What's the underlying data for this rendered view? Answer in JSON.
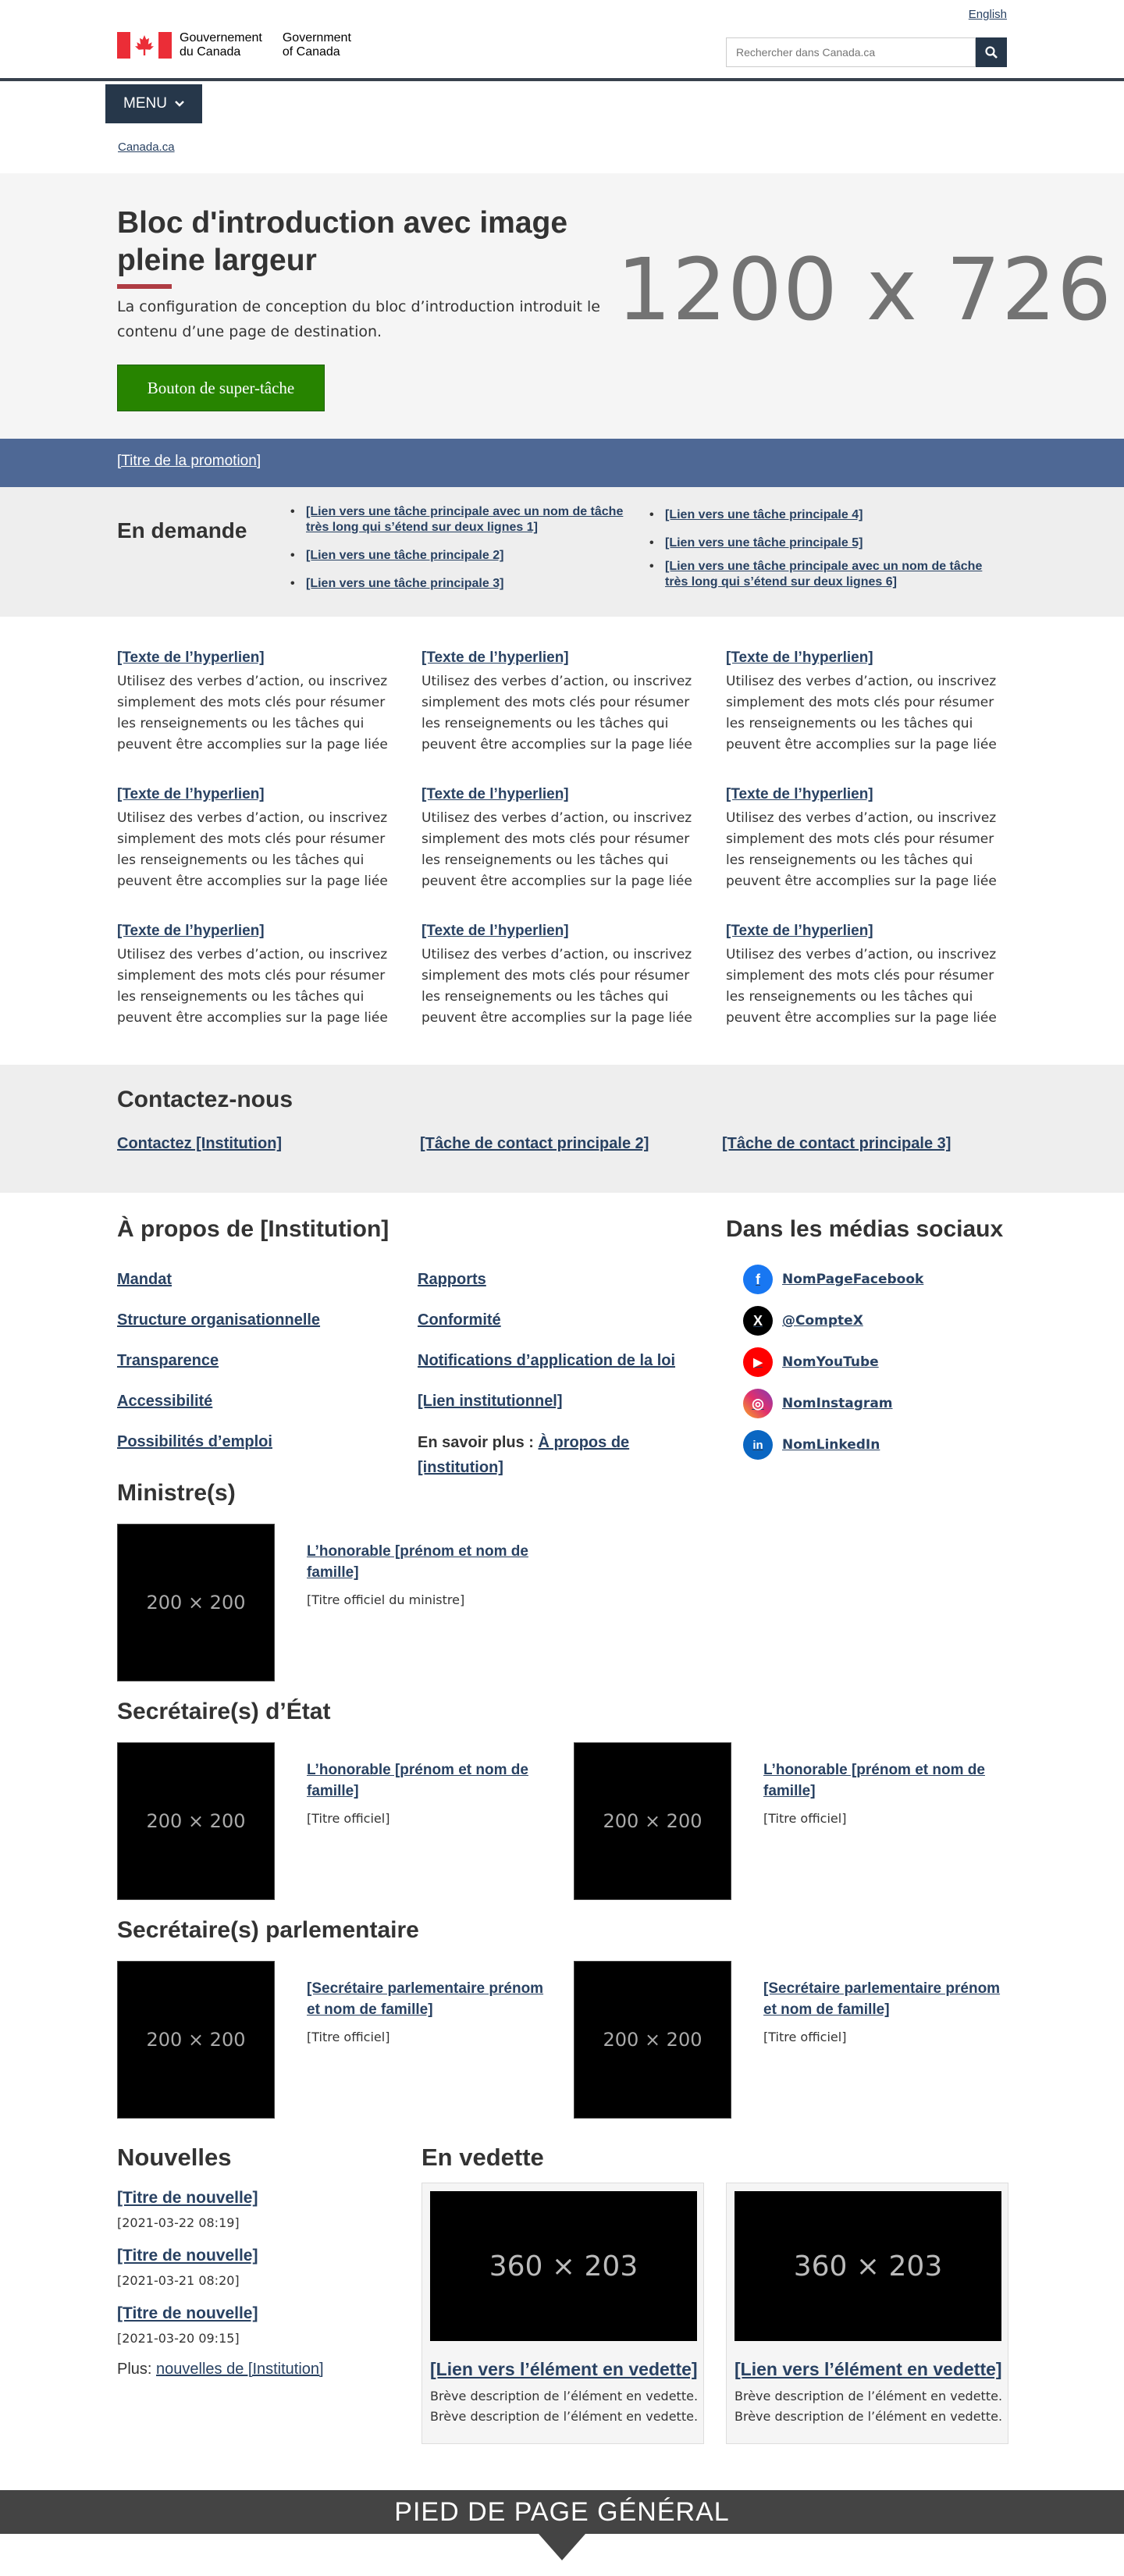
{
  "header": {
    "language_link": "English",
    "signature_fr": "Gouvernement\ndu Canada",
    "signature_en": "Government\nof Canada",
    "search_placeholder": "Rechercher dans Canada.ca"
  },
  "menu": {
    "label": "MENU"
  },
  "breadcrumb": {
    "home": "Canada.ca"
  },
  "hero": {
    "title": "Bloc d'introduction avec image pleine largeur",
    "description": "La configuration de conception du bloc d’introduction introduit le contenu d’une page de destination.",
    "button": "Bouton de super-tâche",
    "image_placeholder": "1200 x 726"
  },
  "promo": {
    "link": "[Titre de la promotion]"
  },
  "in_demand": {
    "title": "En demande",
    "col1": [
      "[Lien vers une tâche principale avec un nom de tâche très long qui s’étend sur deux lignes 1]",
      "[Lien vers une tâche principale 2]",
      "[Lien vers une tâche principale 3]"
    ],
    "col2": [
      "[Lien vers une tâche principale 4]",
      "[Lien vers une tâche principale 5]",
      "[Lien vers une tâche principale avec un nom de tâche très long qui s’étend sur deux lignes 6]"
    ]
  },
  "link_grid": {
    "items": [
      {
        "link": "[Texte de l’hyperlien]",
        "desc": "Utilisez des verbes d’action, ou inscrivez simplement des mots clés pour résumer les renseignements ou les tâches qui peuvent être accomplies sur la page liée"
      },
      {
        "link": "[Texte de l’hyperlien]",
        "desc": "Utilisez des verbes d’action, ou inscrivez simplement des mots clés pour résumer les renseignements ou les tâches qui peuvent être accomplies sur la page liée"
      },
      {
        "link": "[Texte de l’hyperlien]",
        "desc": "Utilisez des verbes d’action, ou inscrivez simplement des mots clés pour résumer les renseignements ou les tâches qui peuvent être accomplies sur la page liée"
      },
      {
        "link": "[Texte de l’hyperlien]",
        "desc": "Utilisez des verbes d’action, ou inscrivez simplement des mots clés pour résumer les renseignements ou les tâches qui peuvent être accomplies sur la page liée"
      },
      {
        "link": "[Texte de l’hyperlien]",
        "desc": "Utilisez des verbes d’action, ou inscrivez simplement des mots clés pour résumer les renseignements ou les tâches qui peuvent être accomplies sur la page liée"
      },
      {
        "link": "[Texte de l’hyperlien]",
        "desc": "Utilisez des verbes d’action, ou inscrivez simplement des mots clés pour résumer les renseignements ou les tâches qui peuvent être accomplies sur la page liée"
      },
      {
        "link": "[Texte de l’hyperlien]",
        "desc": "Utilisez des verbes d’action, ou inscrivez simplement des mots clés pour résumer les renseignements ou les tâches qui peuvent être accomplies sur la page liée"
      },
      {
        "link": "[Texte de l’hyperlien]",
        "desc": "Utilisez des verbes d’action, ou inscrivez simplement des mots clés pour résumer les renseignements ou les tâches qui peuvent être accomplies sur la page liée"
      },
      {
        "link": "[Texte de l’hyperlien]",
        "desc": "Utilisez des verbes d’action, ou inscrivez simplement des mots clés pour résumer les renseignements ou les tâches qui peuvent être accomplies sur la page liée"
      }
    ]
  },
  "contact": {
    "title": "Contactez-nous",
    "links": [
      "Contactez [Institution]",
      "[Tâche de contact principale 2]",
      "[Tâche de contact principale 3]"
    ]
  },
  "about": {
    "title": "À propos de [Institution]",
    "col1": [
      "Mandat",
      "Structure organisationnelle",
      "Transparence",
      "Accessibilité",
      "Possibilités d’emploi"
    ],
    "col2": [
      "Rapports",
      "Conformité",
      "Notifications d’application de la loi",
      "[Lien institutionnel]"
    ],
    "more_prefix": "En savoir plus : ",
    "more_link": "À propos de [institution]"
  },
  "social": {
    "title": "Dans les médias sociaux",
    "items": [
      {
        "icon": "facebook-icon",
        "label": "NomPageFacebook",
        "color": "#1877f2",
        "glyph": "f"
      },
      {
        "icon": "x-icon",
        "label": "@CompteX",
        "color": "#000000",
        "glyph": "X"
      },
      {
        "icon": "youtube-icon",
        "label": "NomYouTube",
        "color": "#ff0000",
        "glyph": "▶"
      },
      {
        "icon": "instagram-icon",
        "label": "NomInstagram",
        "color": "#c13584",
        "glyph": "◎"
      },
      {
        "icon": "linkedin-icon",
        "label": "NomLinkedIn",
        "color": "#0a66c2",
        "glyph": "in"
      }
    ]
  },
  "ministers": {
    "title": "Ministre(s)",
    "items": [
      {
        "image": "200 × 200",
        "name": "L’honorable [prénom et nom de famille]",
        "role": "[Titre officiel du ministre]"
      }
    ]
  },
  "secretaries_state": {
    "title": "Secrétaire(s) d’État",
    "items": [
      {
        "image": "200 × 200",
        "name": "L’honorable [prénom et nom de famille]",
        "role": "[Titre officiel]"
      },
      {
        "image": "200 × 200",
        "name": "L’honorable [prénom et nom de famille]",
        "role": "[Titre officiel]"
      }
    ]
  },
  "parliamentary": {
    "title": "Secrétaire(s) parlementaire",
    "items": [
      {
        "image": "200 × 200",
        "name": "[Secrétaire parlementaire prénom et nom de famille]",
        "role": "[Titre officiel]"
      },
      {
        "image": "200 × 200",
        "name": "[Secrétaire parlementaire prénom et nom de famille]",
        "role": "[Titre officiel]"
      }
    ]
  },
  "news": {
    "title": "Nouvelles",
    "items": [
      {
        "title": "[Titre de nouvelle]",
        "date": "[2021-03-22 08:19]"
      },
      {
        "title": "[Titre de nouvelle]",
        "date": "[2021-03-21 08:20]"
      },
      {
        "title": "[Titre de nouvelle]",
        "date": "[2021-03-20 09:15]"
      }
    ],
    "more_prefix": "Plus: ",
    "more_link": "nouvelles de [Institution]"
  },
  "featured": {
    "title": "En vedette",
    "items": [
      {
        "image": "360 × 203",
        "link": "[Lien vers l’élément en vedette]",
        "desc": "Brève description de l’élément en vedette. Brève description de l’élément en vedette."
      },
      {
        "image": "360 × 203",
        "link": "[Lien vers l’élément en vedette]",
        "desc": "Brève description de l’élément en vedette. Brève description de l’élément en vedette."
      }
    ]
  },
  "footer": {
    "label": "PIED DE PAGE GÉNÉRAL"
  }
}
